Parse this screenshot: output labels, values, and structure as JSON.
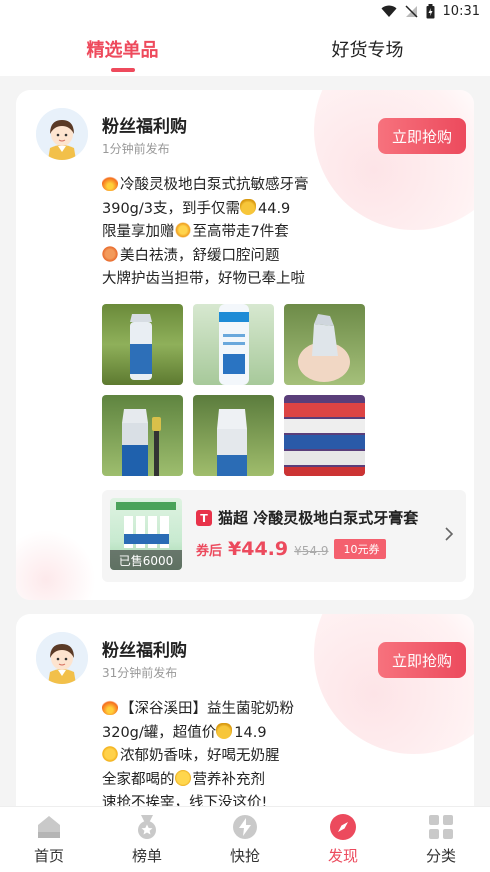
{
  "status_bar": {
    "time": "10:31"
  },
  "tabs": [
    {
      "label": "精选单品",
      "active": true
    },
    {
      "label": "好货专场",
      "active": false
    }
  ],
  "posts": [
    {
      "author": "粉丝福利购",
      "time": "1分钟前发布",
      "buy_label": "立即抢购",
      "lines": [
        {
          "icon": "fire-icon",
          "text": "冷酸灵极地白泵式抗敏感牙膏"
        },
        {
          "icon": "",
          "text": "390g/3支，到手仅需",
          "icon_after": "money-bag-icon",
          "text_after": "44.9"
        },
        {
          "icon": "",
          "text": "限量享加赠",
          "icon_after": "sparkle-icon",
          "text_after": "至高带走7件套"
        },
        {
          "icon": "heart-icon",
          "text": "美白祛渍，舒缓口腔问题"
        },
        {
          "icon": "",
          "text": "大牌护齿当担带，好物已奉上啦"
        }
      ],
      "product": {
        "sold": "已售6000",
        "shop_badge": "T",
        "title": "猫超 冷酸灵极地白泵式牙膏套",
        "after_label": "券后",
        "price": "¥44.9",
        "old_price": "¥54.9",
        "coupon": "10元券"
      }
    },
    {
      "author": "粉丝福利购",
      "time": "31分钟前发布",
      "buy_label": "立即抢购",
      "lines": [
        {
          "icon": "fire-icon",
          "text": "【深谷溪田】益生菌驼奶粉"
        },
        {
          "icon": "",
          "text": "320g/罐，超值价",
          "icon_after": "money-bag-icon",
          "text_after": "14.9"
        },
        {
          "icon": "clap-icon",
          "text": "浓郁奶香味，好喝无奶腥"
        },
        {
          "icon": "",
          "text": "全家都喝的",
          "icon_after": "smile-icon",
          "text_after": "营养补充剂"
        },
        {
          "icon": "",
          "text": "速抢不挨宰，线下没这价!"
        }
      ]
    }
  ],
  "bottom_nav": [
    {
      "label": "首页",
      "icon": "home-icon",
      "active": false
    },
    {
      "label": "榜单",
      "icon": "medal-icon",
      "active": false
    },
    {
      "label": "快抢",
      "icon": "lightning-icon",
      "active": false
    },
    {
      "label": "发现",
      "icon": "compass-icon",
      "active": true
    },
    {
      "label": "分类",
      "icon": "grid-icon",
      "active": false
    }
  ],
  "colors": {
    "accent": "#ec4a5d",
    "background": "#f4f4f4"
  }
}
